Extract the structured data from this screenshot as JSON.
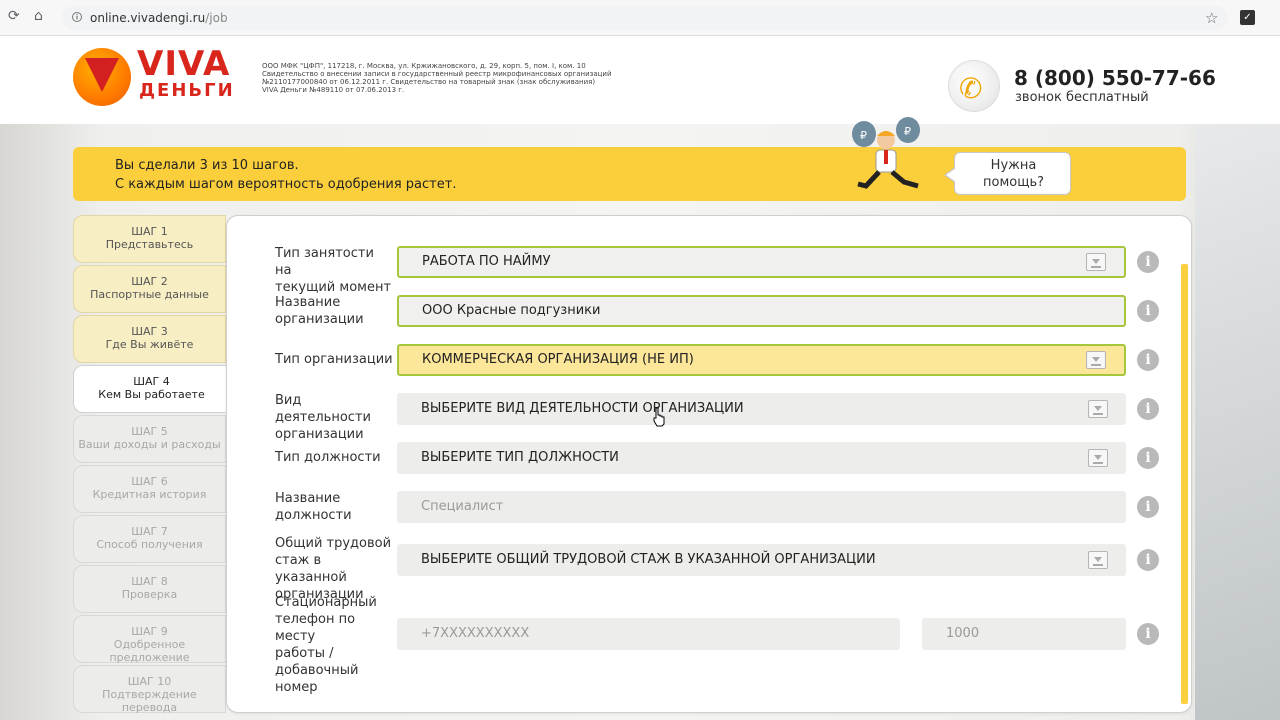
{
  "browser": {
    "url_domain": "online.vivadengi.ru",
    "url_path": "/job"
  },
  "header": {
    "logo_line1": "VIVA",
    "logo_line2": "ДЕНЬГИ",
    "legal": [
      "ООО МФК \"ЦФП\", 117218, г. Москва, ул. Кржижановского, д. 29, корп. 5, пом. I, ком. 10",
      "Свидетельство о внесении записи в государственный реестр микрофинансовых организаций",
      "№2110177000840 от 06.12.2011 г. Свидетельство на товарный знак (знак обслуживания)",
      "VIVA Деньги №489110 от 07.06.2013 г."
    ],
    "phone": "8 (800) 550-77-66",
    "phone_note": "звонок бесплатный"
  },
  "banner": {
    "line1": "Вы сделали 3 из 10 шагов.",
    "line2": "С каждым шагом вероятность одобрения растет.",
    "help_line1": "Нужна",
    "help_line2": "помощь?"
  },
  "steps": [
    {
      "num": "ШАГ 1",
      "title": "Представьтесь",
      "state": "done"
    },
    {
      "num": "ШАГ 2",
      "title": "Паспортные данные",
      "state": "done"
    },
    {
      "num": "ШАГ 3",
      "title": "Где Вы живёте",
      "state": "done"
    },
    {
      "num": "ШАГ 4",
      "title": "Кем Вы работаете",
      "state": "active"
    },
    {
      "num": "ШАГ 5",
      "title": "Ваши доходы и расходы",
      "state": "future"
    },
    {
      "num": "ШАГ 6",
      "title": "Кредитная история",
      "state": "future"
    },
    {
      "num": "ШАГ 7",
      "title": "Способ получения",
      "state": "future"
    },
    {
      "num": "ШАГ 8",
      "title": "Проверка",
      "state": "future"
    },
    {
      "num": "ШАГ 9",
      "title": "Одобренное предложение",
      "state": "future"
    },
    {
      "num": "ШАГ 10",
      "title": "Подтверждение перевода",
      "state": "future"
    }
  ],
  "form": {
    "employment_type": {
      "label_1": "Тип занятости на",
      "label_2": "текущий момент",
      "value": "РАБОТА ПО НАЙМУ"
    },
    "org_name": {
      "label_1": "Название",
      "label_2": "организации",
      "value": "ООО Красные подгузники"
    },
    "org_type": {
      "label_1": "Тип организации",
      "value": "КОММЕРЧЕСКАЯ ОРГАНИЗАЦИЯ (НЕ ИП)"
    },
    "activity": {
      "label_1": "Вид деятельности",
      "label_2": "организации",
      "value": "ВЫБЕРИТЕ ВИД ДЕЯТЕЛЬНОСТИ ОРГАНИЗАЦИИ"
    },
    "position_type": {
      "label_1": "Тип должности",
      "value": "ВЫБЕРИТЕ ТИП ДОЛЖНОСТИ"
    },
    "position_name": {
      "label_1": "Название",
      "label_2": "должности",
      "placeholder": "Специалист"
    },
    "experience": {
      "label_1": "Общий трудовой",
      "label_2": "стаж в указанной",
      "label_3": "организации",
      "value": "ВЫБЕРИТЕ ОБЩИЙ ТРУДОВОЙ СТАЖ В УКАЗАННОЙ ОРГАНИЗАЦИИ"
    },
    "work_phone": {
      "label_1": "Стационарный",
      "label_2": "телефон по месту",
      "label_3": "работы /",
      "label_4": "добавочный",
      "label_5": "номер",
      "placeholder": "+7XXXXXXXXXX",
      "ext_placeholder": "1000"
    },
    "info_glyph": "i"
  },
  "colors": {
    "accent_yellow": "#fbcf3b",
    "valid_green": "#a6c63b",
    "brand_red": "#d9261c"
  }
}
